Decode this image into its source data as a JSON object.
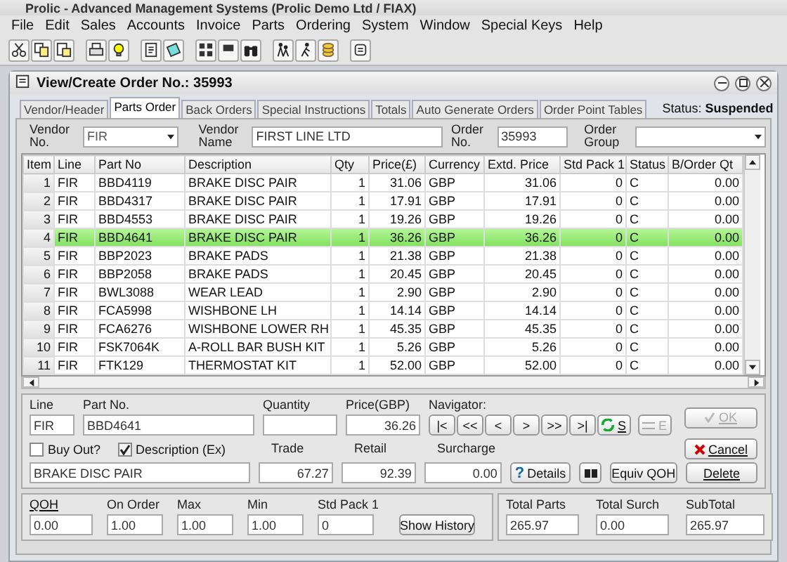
{
  "window": {
    "title": "Prolic - Advanced Management Systems (Prolic Demo Ltd / FIAX)"
  },
  "menu": [
    "File",
    "Edit",
    "Sales",
    "Accounts",
    "Invoice",
    "Parts",
    "Ordering",
    "System",
    "Window",
    "Special Keys",
    "Help"
  ],
  "document": {
    "title": "View/Create Order No.:  35993",
    "tabs": [
      {
        "label": "Vendor/Header",
        "selected": false
      },
      {
        "label": "Parts Order",
        "selected": true
      },
      {
        "label": "Back Orders",
        "selected": false
      },
      {
        "label": "Special Instructions",
        "selected": false
      },
      {
        "label": "Totals",
        "selected": false
      },
      {
        "label": "Auto Generate Orders",
        "selected": false
      },
      {
        "label": "Order Point Tables",
        "selected": false
      }
    ],
    "status_label": "Status:",
    "status": "Suspended"
  },
  "header": {
    "vendor_no_label": "Vendor No.",
    "vendor_no": "FIR",
    "vendor_name_label": "Vendor Name",
    "vendor_name": "FIRST LINE LTD",
    "order_no_label": "Order No.",
    "order_no": "35993",
    "order_group_label": "Order Group"
  },
  "table": {
    "columns": [
      "Item",
      "Line",
      "Part No",
      "Description",
      "Qty",
      "Price(£)",
      "Currency",
      "Extd. Price",
      "Std Pack 1",
      "Status",
      "B/Order Qt"
    ],
    "rows": [
      {
        "selected": false,
        "cells": [
          "1",
          "FIR",
          "BBD4119",
          "BRAKE DISC PAIR",
          "1",
          "31.06",
          "GBP",
          "31.06",
          "0",
          "C",
          "0.00"
        ]
      },
      {
        "selected": false,
        "cells": [
          "2",
          "FIR",
          "BBD4317",
          "BRAKE DISC PAIR",
          "1",
          "17.91",
          "GBP",
          "17.91",
          "0",
          "C",
          "0.00"
        ]
      },
      {
        "selected": false,
        "cells": [
          "3",
          "FIR",
          "BBD4553",
          "BRAKE DISC PAIR",
          "1",
          "19.26",
          "GBP",
          "19.26",
          "0",
          "C",
          "0.00"
        ]
      },
      {
        "selected": true,
        "cells": [
          "4",
          "FIR",
          "BBD4641",
          "BRAKE DISC PAIR",
          "1",
          "36.26",
          "GBP",
          "36.26",
          "0",
          "C",
          "0.00"
        ]
      },
      {
        "selected": false,
        "cells": [
          "5",
          "FIR",
          "BBP2023",
          "BRAKE PADS",
          "1",
          "21.38",
          "GBP",
          "21.38",
          "0",
          "C",
          "0.00"
        ]
      },
      {
        "selected": false,
        "cells": [
          "6",
          "FIR",
          "BBP2058",
          "BRAKE PADS",
          "1",
          "20.45",
          "GBP",
          "20.45",
          "0",
          "C",
          "0.00"
        ]
      },
      {
        "selected": false,
        "cells": [
          "7",
          "FIR",
          "BWL3088",
          "WEAR LEAD",
          "1",
          "2.90",
          "GBP",
          "2.90",
          "0",
          "C",
          "0.00"
        ]
      },
      {
        "selected": false,
        "cells": [
          "8",
          "FIR",
          "FCA5998",
          "WISHBONE LH",
          "1",
          "14.14",
          "GBP",
          "14.14",
          "0",
          "C",
          "0.00"
        ]
      },
      {
        "selected": false,
        "cells": [
          "9",
          "FIR",
          "FCA6276",
          "WISHBONE LOWER RH",
          "1",
          "45.35",
          "GBP",
          "45.35",
          "0",
          "C",
          "0.00"
        ]
      },
      {
        "selected": false,
        "cells": [
          "10",
          "FIR",
          "FSK7064K",
          "A-ROLL BAR BUSH KIT",
          "1",
          "5.26",
          "GBP",
          "5.26",
          "0",
          "C",
          "0.00"
        ]
      },
      {
        "selected": false,
        "cells": [
          "11",
          "FIR",
          "FTK129",
          "THERMOSTAT KIT",
          "1",
          "52.00",
          "GBP",
          "52.00",
          "0",
          "C",
          "0.00"
        ]
      }
    ]
  },
  "detail": {
    "line_label": "Line",
    "line": "FIR",
    "part_label": "Part No.",
    "part": "BBD4641",
    "quantity_label": "Quantity",
    "price_label": "Price(GBP)",
    "price": "36.26",
    "buy_out": {
      "label": "Buy Out?",
      "checked": false
    },
    "description_ex": {
      "label": "Description (Ex)",
      "checked": true
    },
    "description": "BRAKE DISC PAIR",
    "trade_label": "Trade",
    "trade": "67.27",
    "retail_label": "Retail",
    "retail": "92.39",
    "navigator_label": "Navigator:",
    "navigator": [
      "|<",
      "<<",
      "<",
      ">",
      ">>",
      ">|"
    ],
    "save": "S",
    "edit": "E",
    "surcharge_label": "Surcharge",
    "surcharge": "0.00",
    "details_icon": "?",
    "details": "Details",
    "equiv": "Equiv QOH",
    "ok": "OK",
    "cancel": "Cancel",
    "delete": "Delete"
  },
  "stock": {
    "qoh_label": "QOH",
    "qoh": "0.00",
    "on_order_label": "On Order",
    "on_order": "1.00",
    "max_label": "Max",
    "max": "1.00",
    "min_label": "Min",
    "min": "1.00",
    "std_pack_label": "Std Pack 1",
    "std_pack": "0",
    "history": "Show History"
  },
  "totals": {
    "parts_label": "Total Parts",
    "parts": "265.97",
    "surch_label": "Total Surch",
    "surch": "0.00",
    "subtotal_label": "SubTotal",
    "subtotal": "265.97"
  }
}
